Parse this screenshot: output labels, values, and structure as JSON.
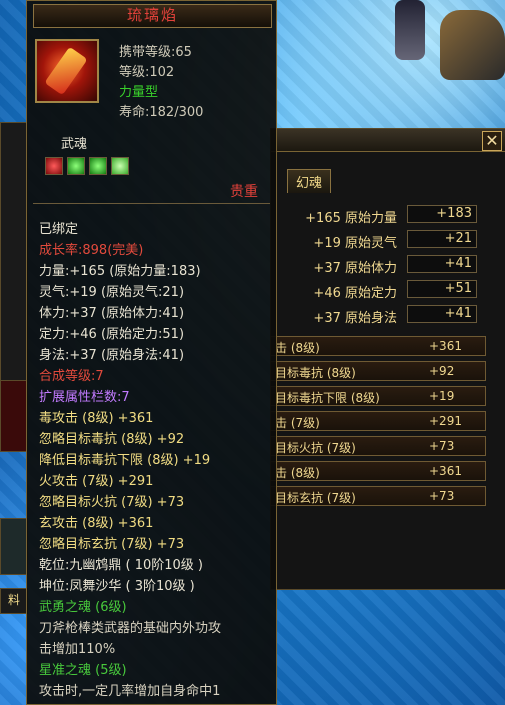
{
  "item": {
    "name": "琉璃焰",
    "carry_level": "携带等级:65",
    "level": "等级:102",
    "type": "力量型",
    "lifespan": "寿命:182/300"
  },
  "wuhun": {
    "label": "武魂",
    "gems": [
      "red",
      "green",
      "green",
      "ltgreen"
    ],
    "rarity": "贵重"
  },
  "tooltip_lines": [
    {
      "text": "已绑定",
      "color": "white"
    },
    {
      "text": "成长率:898(完美)",
      "color": "red"
    },
    {
      "text": "力量:+165  (原始力量:183)",
      "color": "white"
    },
    {
      "text": "灵气:+19  (原始灵气:21)",
      "color": "white"
    },
    {
      "text": "体力:+37  (原始体力:41)",
      "color": "white"
    },
    {
      "text": "定力:+46  (原始定力:51)",
      "color": "white"
    },
    {
      "text": "身法:+37  (原始身法:41)",
      "color": "white"
    },
    {
      "text": "合成等级:7",
      "color": "red"
    },
    {
      "text": "扩展属性栏数:7",
      "color": "purple"
    },
    {
      "text": "毒攻击 (8级) +361",
      "color": "yellow"
    },
    {
      "text": "忽略目标毒抗 (8级) +92",
      "color": "yellow"
    },
    {
      "text": "降低目标毒抗下限 (8级) +19",
      "color": "yellow"
    },
    {
      "text": "火攻击 (7级) +291",
      "color": "yellow"
    },
    {
      "text": "忽略目标火抗 (7级) +73",
      "color": "yellow"
    },
    {
      "text": "玄攻击 (8级) +361",
      "color": "yellow"
    },
    {
      "text": "忽略目标玄抗 (7级) +73",
      "color": "yellow"
    },
    {
      "text": "乾位:九幽鸩鼎 ( 10阶10级 )",
      "color": "white"
    },
    {
      "text": "坤位:凤舞沙华 ( 3阶10级 )",
      "color": "white"
    },
    {
      "text": "武勇之魂 (6级)",
      "color": "green"
    },
    {
      "text": "刀斧枪棒类武器的基础内外功攻",
      "color": "grey"
    },
    {
      "text": "击增加110%",
      "color": "grey"
    },
    {
      "text": "星准之魂 (5级)",
      "color": "green"
    },
    {
      "text": "攻击时,一定几率增加自身命中1",
      "color": "grey"
    }
  ],
  "back_window": {
    "tab": "幻魂",
    "close_label": "✕",
    "attributes": [
      {
        "label": "+165 原始力量",
        "value": "+183"
      },
      {
        "label": "+19 原始灵气",
        "value": "+21"
      },
      {
        "label": "+37 原始体力",
        "value": "+41"
      },
      {
        "label": "+46 原始定力",
        "value": "+51"
      },
      {
        "label": "+37 原始身法",
        "value": "+41"
      }
    ],
    "stats": [
      {
        "name": "击 (8级)",
        "value": "+361"
      },
      {
        "name": "目标毒抗 (8级)",
        "value": "+92"
      },
      {
        "name": "目标毒抗下限 (8级)",
        "value": "+19"
      },
      {
        "name": "击 (7级)",
        "value": "+291"
      },
      {
        "name": "目标火抗 (7级)",
        "value": "+73"
      },
      {
        "name": "击 (8级)",
        "value": "+361"
      },
      {
        "name": "目标玄抗 (7级)",
        "value": "+73"
      }
    ],
    "left_fragment_label": "料"
  }
}
